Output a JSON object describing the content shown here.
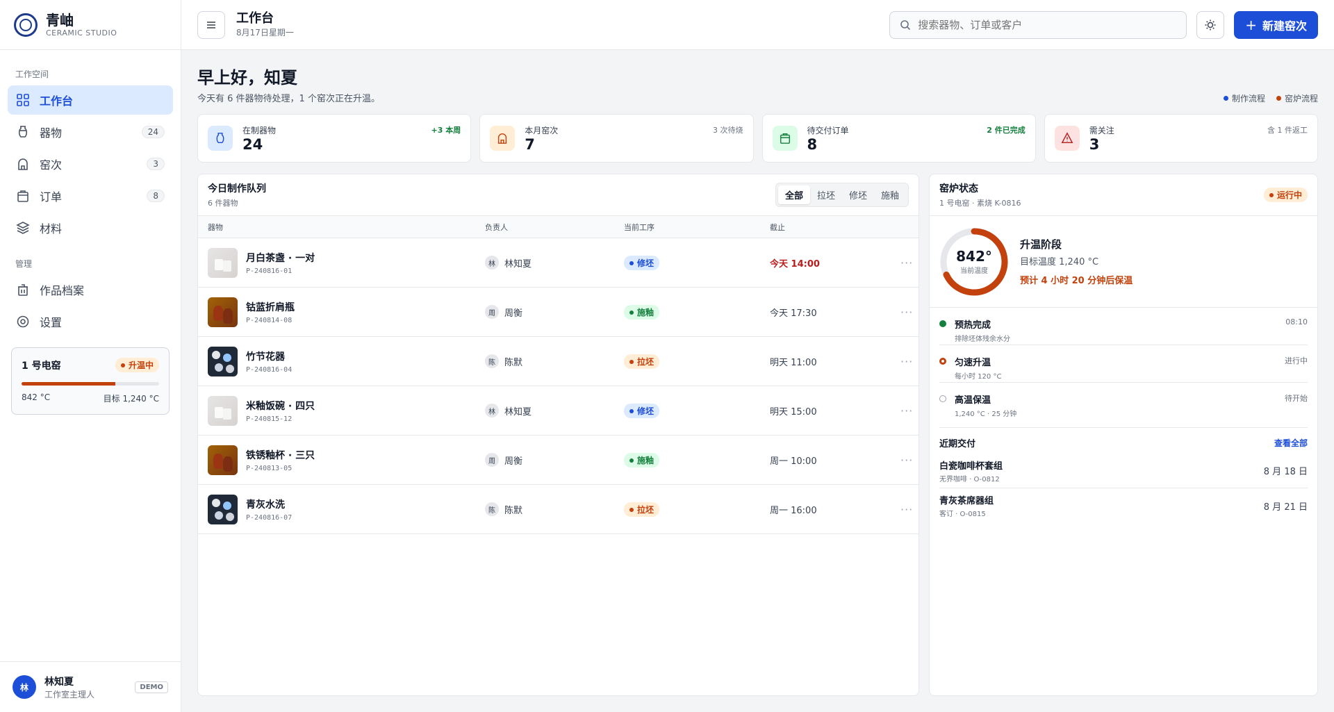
{
  "brand": {
    "name": "青岫",
    "sub": "CERAMIC STUDIO"
  },
  "nav": {
    "workspace_label": "工作空间",
    "manage_label": "管理",
    "items": [
      {
        "label": "工作台",
        "icon": "grid-icon",
        "badge": ""
      },
      {
        "label": "器物",
        "icon": "vase-icon",
        "badge": "24"
      },
      {
        "label": "窑次",
        "icon": "kiln-icon",
        "badge": "3"
      },
      {
        "label": "订单",
        "icon": "bag-icon",
        "badge": "8"
      },
      {
        "label": "材料",
        "icon": "layers-icon",
        "badge": ""
      }
    ],
    "manage_items": [
      {
        "label": "作品档案",
        "icon": "archive-icon"
      },
      {
        "label": "设置",
        "icon": "gear-icon"
      }
    ]
  },
  "kiln_card": {
    "name": "1 号电窑",
    "status": "升温中",
    "progress": 0.68,
    "current": "842 °C",
    "target": "目标 1,240 °C"
  },
  "user": {
    "initial": "林",
    "name": "林知夏",
    "role": "工作室主理人",
    "tag": "DEMO"
  },
  "topbar": {
    "title": "工作台",
    "date": "8月17日星期一",
    "search_placeholder": "搜索器物、订单或客户",
    "new_button": "新建窑次"
  },
  "greeting": {
    "title": "早上好，知夏",
    "subtitle": "今天有 6 件器物待处理，1 个窑次正在升温。",
    "legend": [
      {
        "label": "制作流程",
        "color": "#1d4ed8"
      },
      {
        "label": "窑炉流程",
        "color": "#c2410c"
      }
    ]
  },
  "stats": [
    {
      "label": "在制器物",
      "value": "24",
      "note": "+3 本周",
      "icon": "vase-icon"
    },
    {
      "label": "本月窑次",
      "value": "7",
      "note": "3 次待烧",
      "icon": "kiln-icon"
    },
    {
      "label": "待交付订单",
      "value": "8",
      "note": "2 件已完成",
      "icon": "bag-icon"
    },
    {
      "label": "需关注",
      "value": "3",
      "note": "含 1 件返工",
      "icon": "warning-icon"
    }
  ],
  "queue": {
    "title": "今日制作队列",
    "subtitle": "6 件器物",
    "filters": [
      "全部",
      "拉坯",
      "修坯",
      "施釉"
    ],
    "columns": [
      "器物",
      "负责人",
      "当前工序",
      "截止"
    ],
    "rows": [
      {
        "name": "月白茶盏 · 一对",
        "code": "P-240816-01",
        "owner_initial": "林",
        "owner": "林知夏",
        "stage": "修坯",
        "due": "今天 14:00"
      },
      {
        "name": "钴蓝折肩瓶",
        "code": "P-240814-08",
        "owner_initial": "周",
        "owner": "周衡",
        "stage": "施釉",
        "due": "今天 17:30"
      },
      {
        "name": "竹节花器",
        "code": "P-240816-04",
        "owner_initial": "陈",
        "owner": "陈默",
        "stage": "拉坯",
        "due": "明天 11:00"
      },
      {
        "name": "米釉饭碗 · 四只",
        "code": "P-240815-12",
        "owner_initial": "林",
        "owner": "林知夏",
        "stage": "修坯",
        "due": "明天 15:00"
      },
      {
        "name": "铁锈釉杯 · 三只",
        "code": "P-240813-05",
        "owner_initial": "周",
        "owner": "周衡",
        "stage": "施釉",
        "due": "周一 10:00"
      },
      {
        "name": "青灰水洗",
        "code": "P-240816-07",
        "owner_initial": "陈",
        "owner": "陈默",
        "stage": "拉坯",
        "due": "周一 16:00"
      }
    ],
    "more": "···"
  },
  "kiln_status": {
    "title": "窑炉状态",
    "subtitle": "1 号电窑 · 素烧 K-0816",
    "status": "运行中",
    "temp": "842°",
    "temp_label": "当前温度",
    "progress": 0.68,
    "phase": "升温阶段",
    "target": "目标温度 1,240 °C",
    "eta": "预计 4 小时 20 分钟后保温",
    "steps": [
      {
        "name": "预热完成",
        "desc": "排除坯体残余水分",
        "time": "08:10",
        "state": "done"
      },
      {
        "name": "匀速升温",
        "desc": "每小时 120 °C",
        "time": "进行中",
        "state": "active"
      },
      {
        "name": "高温保温",
        "desc": "1,240 °C · 25 分钟",
        "time": "待开始",
        "state": "pending"
      }
    ]
  },
  "deliveries": {
    "title": "近期交付",
    "link": "查看全部",
    "items": [
      {
        "name": "白瓷咖啡杯套组",
        "meta": "无界咖啡 · O-0812",
        "date": "8 月 18 日"
      },
      {
        "name": "青灰茶席器组",
        "meta": "客订 · O-0815",
        "date": "8 月 21 日"
      }
    ]
  }
}
